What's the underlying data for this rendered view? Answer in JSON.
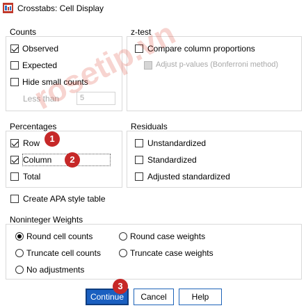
{
  "title": "Crosstabs: Cell Display",
  "counts": {
    "label": "Counts",
    "observed": "Observed",
    "expected": "Expected",
    "hide_small": "Hide small counts",
    "less_than": "Less than",
    "less_than_value": "5"
  },
  "ztest": {
    "label": "z-test",
    "compare": "Compare column proportions",
    "adjust": "Adjust p-values (Bonferroni method)"
  },
  "percentages": {
    "label": "Percentages",
    "row": "Row",
    "column": "Column",
    "total": "Total"
  },
  "residuals": {
    "label": "Residuals",
    "unstandardized": "Unstandardized",
    "standardized": "Standardized",
    "adjusted": "Adjusted standardized"
  },
  "apa": "Create APA style table",
  "noninteger": {
    "label": "Noninteger Weights",
    "round_cell": "Round cell counts",
    "round_case": "Round case weights",
    "truncate_cell": "Truncate cell counts",
    "truncate_case": "Truncate case weights",
    "no_adjust": "No adjustments"
  },
  "buttons": {
    "continue": "Continue",
    "cancel": "Cancel",
    "help": "Help"
  },
  "badges": [
    "1",
    "2",
    "3"
  ],
  "watermark": "rosetip.vn",
  "colors": {
    "badge": "#c62828",
    "primary_button": "#1a5fc0"
  }
}
